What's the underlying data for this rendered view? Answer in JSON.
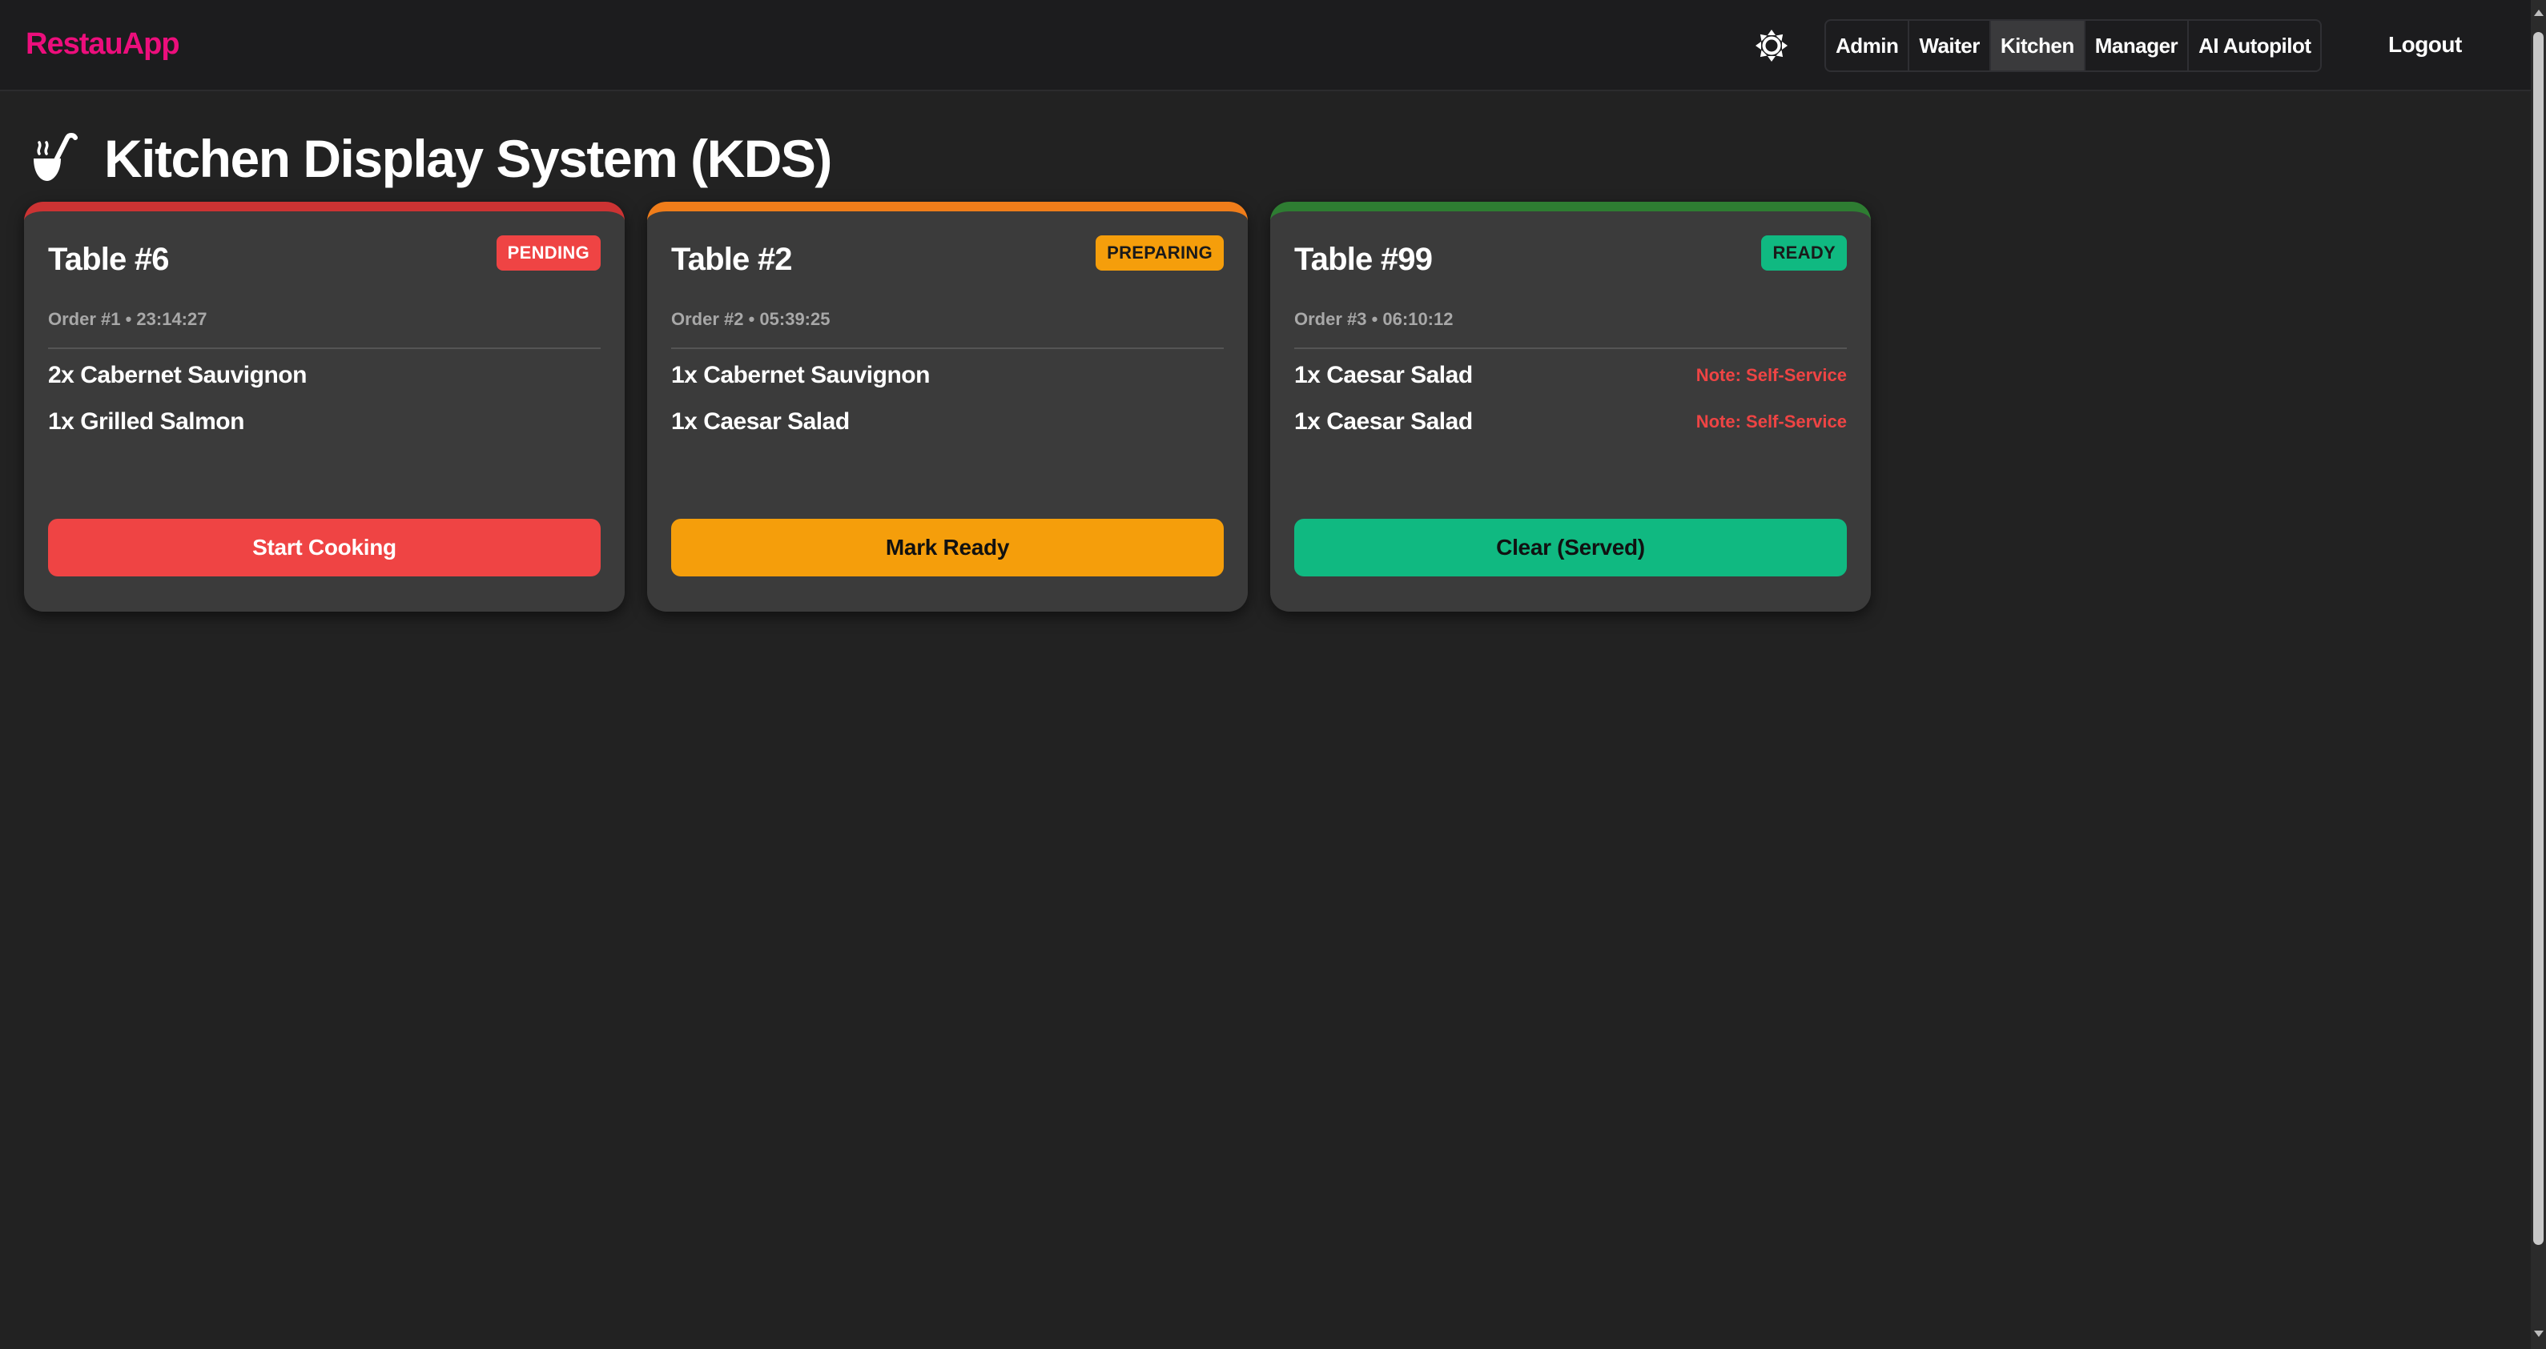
{
  "app": {
    "brand": "RestauApp"
  },
  "header": {
    "theme_toggle_icon": "sun-icon",
    "nav": [
      {
        "label": "Admin",
        "active": false
      },
      {
        "label": "Waiter",
        "active": false
      },
      {
        "label": "Kitchen",
        "active": true
      },
      {
        "label": "Manager",
        "active": false
      },
      {
        "label": "AI Autopilot",
        "active": false
      }
    ],
    "logout_label": "Logout"
  },
  "page": {
    "title": "Kitchen Display System (KDS)",
    "title_icon": "ladle-icon"
  },
  "orders": [
    {
      "table": "Table #6",
      "status": "PENDING",
      "meta": "Order #1 • 23:14:27",
      "items": [
        {
          "name": "2x Cabernet Sauvignon",
          "note": ""
        },
        {
          "name": "1x Grilled Salmon",
          "note": ""
        }
      ],
      "action": "Start Cooking"
    },
    {
      "table": "Table #2",
      "status": "PREPARING",
      "meta": "Order #2 • 05:39:25",
      "items": [
        {
          "name": "1x Cabernet Sauvignon",
          "note": ""
        },
        {
          "name": "1x Caesar Salad",
          "note": ""
        }
      ],
      "action": "Mark Ready"
    },
    {
      "table": "Table #99",
      "status": "READY",
      "meta": "Order #3 • 06:10:12",
      "items": [
        {
          "name": "1x Caesar Salad",
          "note": "Note: Self-Service"
        },
        {
          "name": "1x Caesar Salad",
          "note": "Note: Self-Service"
        }
      ],
      "action": "Clear (Served)"
    }
  ],
  "colors": {
    "brand": "#ec0e7c",
    "pending": "#ef4444",
    "preparing": "#f59e0b",
    "ready": "#10b981",
    "background": "#222222",
    "card": "#3b3b3b"
  }
}
